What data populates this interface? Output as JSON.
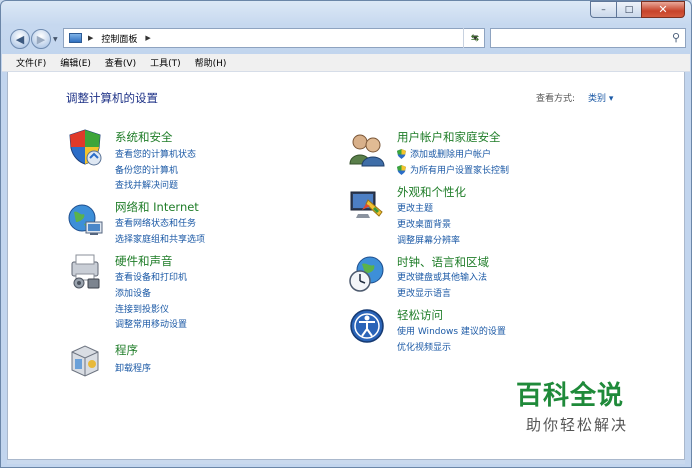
{
  "window": {
    "caption_min": "–",
    "caption_max": "□",
    "caption_close": "✕"
  },
  "address": {
    "path": "控制面板",
    "search_placeholder": ""
  },
  "menu": [
    "文件(F)",
    "编辑(E)",
    "查看(V)",
    "工具(T)",
    "帮助(H)"
  ],
  "page": {
    "title": "调整计算机的设置",
    "view_by_label": "查看方式:",
    "view_by_value": "类别 ▾"
  },
  "categories": {
    "system": {
      "title": "系统和安全",
      "links": [
        "查看您的计算机状态",
        "备份您的计算机",
        "查找并解决问题"
      ]
    },
    "network": {
      "title": "网络和 Internet",
      "links": [
        "查看网络状态和任务",
        "选择家庭组和共享选项"
      ]
    },
    "hardware": {
      "title": "硬件和声音",
      "links": [
        "查看设备和打印机",
        "添加设备",
        "连接到投影仪",
        "调整常用移动设置"
      ]
    },
    "programs": {
      "title": "程序",
      "links": [
        "卸载程序"
      ]
    },
    "users": {
      "title": "用户帐户和家庭安全",
      "links": [
        "添加或删除用户帐户",
        "为所有用户设置家长控制"
      ]
    },
    "appearance": {
      "title": "外观和个性化",
      "links": [
        "更改主题",
        "更改桌面背景",
        "调整屏幕分辨率"
      ]
    },
    "clock": {
      "title": "时钟、语言和区域",
      "links": [
        "更改键盘或其他输入法",
        "更改显示语言"
      ]
    },
    "ease": {
      "title": "轻松访问",
      "links": [
        "使用 Windows 建议的设置",
        "优化视频显示"
      ]
    }
  },
  "watermark": {
    "title": "百科全说",
    "subtitle": "助你轻松解决"
  }
}
